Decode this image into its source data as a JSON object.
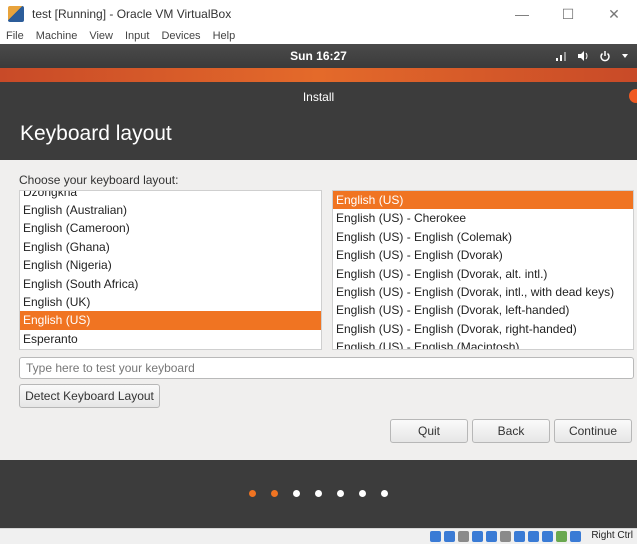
{
  "window": {
    "title": "test [Running] - Oracle VM VirtualBox",
    "controls": {
      "minimize": "—",
      "maximize": "☐",
      "close": "✕"
    }
  },
  "menubar": {
    "items": [
      {
        "label": "File"
      },
      {
        "label": "Machine"
      },
      {
        "label": "View"
      },
      {
        "label": "Input"
      },
      {
        "label": "Devices"
      },
      {
        "label": "Help"
      }
    ]
  },
  "topbar": {
    "clock": "Sun 16:27",
    "icons": [
      "network-icon",
      "volume-icon",
      "power-icon",
      "chevron-down-icon"
    ]
  },
  "installer": {
    "header_title": "Install",
    "page_title": "Keyboard layout",
    "prompt": "Choose your keyboard layout:",
    "layouts": [
      {
        "label": "Dzongkha",
        "clipped": true
      },
      {
        "label": "English (Australian)"
      },
      {
        "label": "English (Cameroon)"
      },
      {
        "label": "English (Ghana)"
      },
      {
        "label": "English (Nigeria)"
      },
      {
        "label": "English (South Africa)"
      },
      {
        "label": "English (UK)"
      },
      {
        "label": "English (US)",
        "selected": true
      },
      {
        "label": "Esperanto"
      }
    ],
    "variants": [
      {
        "label": "English (US)",
        "selected": true
      },
      {
        "label": "English (US) - Cherokee"
      },
      {
        "label": "English (US) - English (Colemak)"
      },
      {
        "label": "English (US) - English (Dvorak)"
      },
      {
        "label": "English (US) - English (Dvorak, alt. intl.)"
      },
      {
        "label": "English (US) - English (Dvorak, intl., with dead keys)"
      },
      {
        "label": "English (US) - English (Dvorak, left-handed)"
      },
      {
        "label": "English (US) - English (Dvorak, right-handed)"
      },
      {
        "label": "English (US) - English (Macintosh)",
        "clipped": true
      }
    ],
    "test_input": {
      "placeholder": "Type here to test your keyboard",
      "value": ""
    },
    "detect_button": "Detect Keyboard Layout",
    "quit_button": "Quit",
    "back_button": "Back",
    "continue_button": "Continue",
    "progress": {
      "total_steps": 7,
      "current_step": 2
    },
    "accent_color": "#f07422"
  },
  "statusbar": {
    "host_key": "Right Ctrl"
  }
}
